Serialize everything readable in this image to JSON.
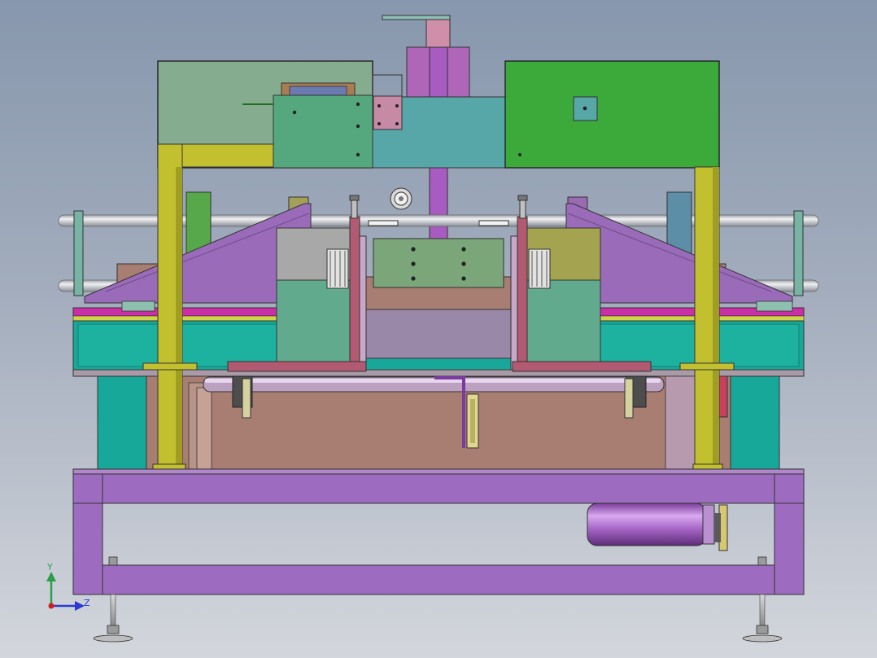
{
  "viewport": {
    "background_top": "#8797ad",
    "background_bottom": "#d3d6dc"
  },
  "axis_triad": {
    "y_label": "Y",
    "z_label": "Z",
    "y_color": "#2aa04a",
    "z_color": "#2a3ad0",
    "origin_color": "#d02020"
  },
  "colors": {
    "frame_purple": "#9d6cc0",
    "pole_yellow": "#c2c02e",
    "teal": "#18a89a",
    "green_panel": "#3caa3a",
    "grey_green_panel": "#86ac90",
    "mauve": "#9c6aae",
    "brown": "#a87d72",
    "pink": "#b47a90",
    "rod_silver": "#c9ccd2",
    "motor_purple": "#a666c6"
  }
}
